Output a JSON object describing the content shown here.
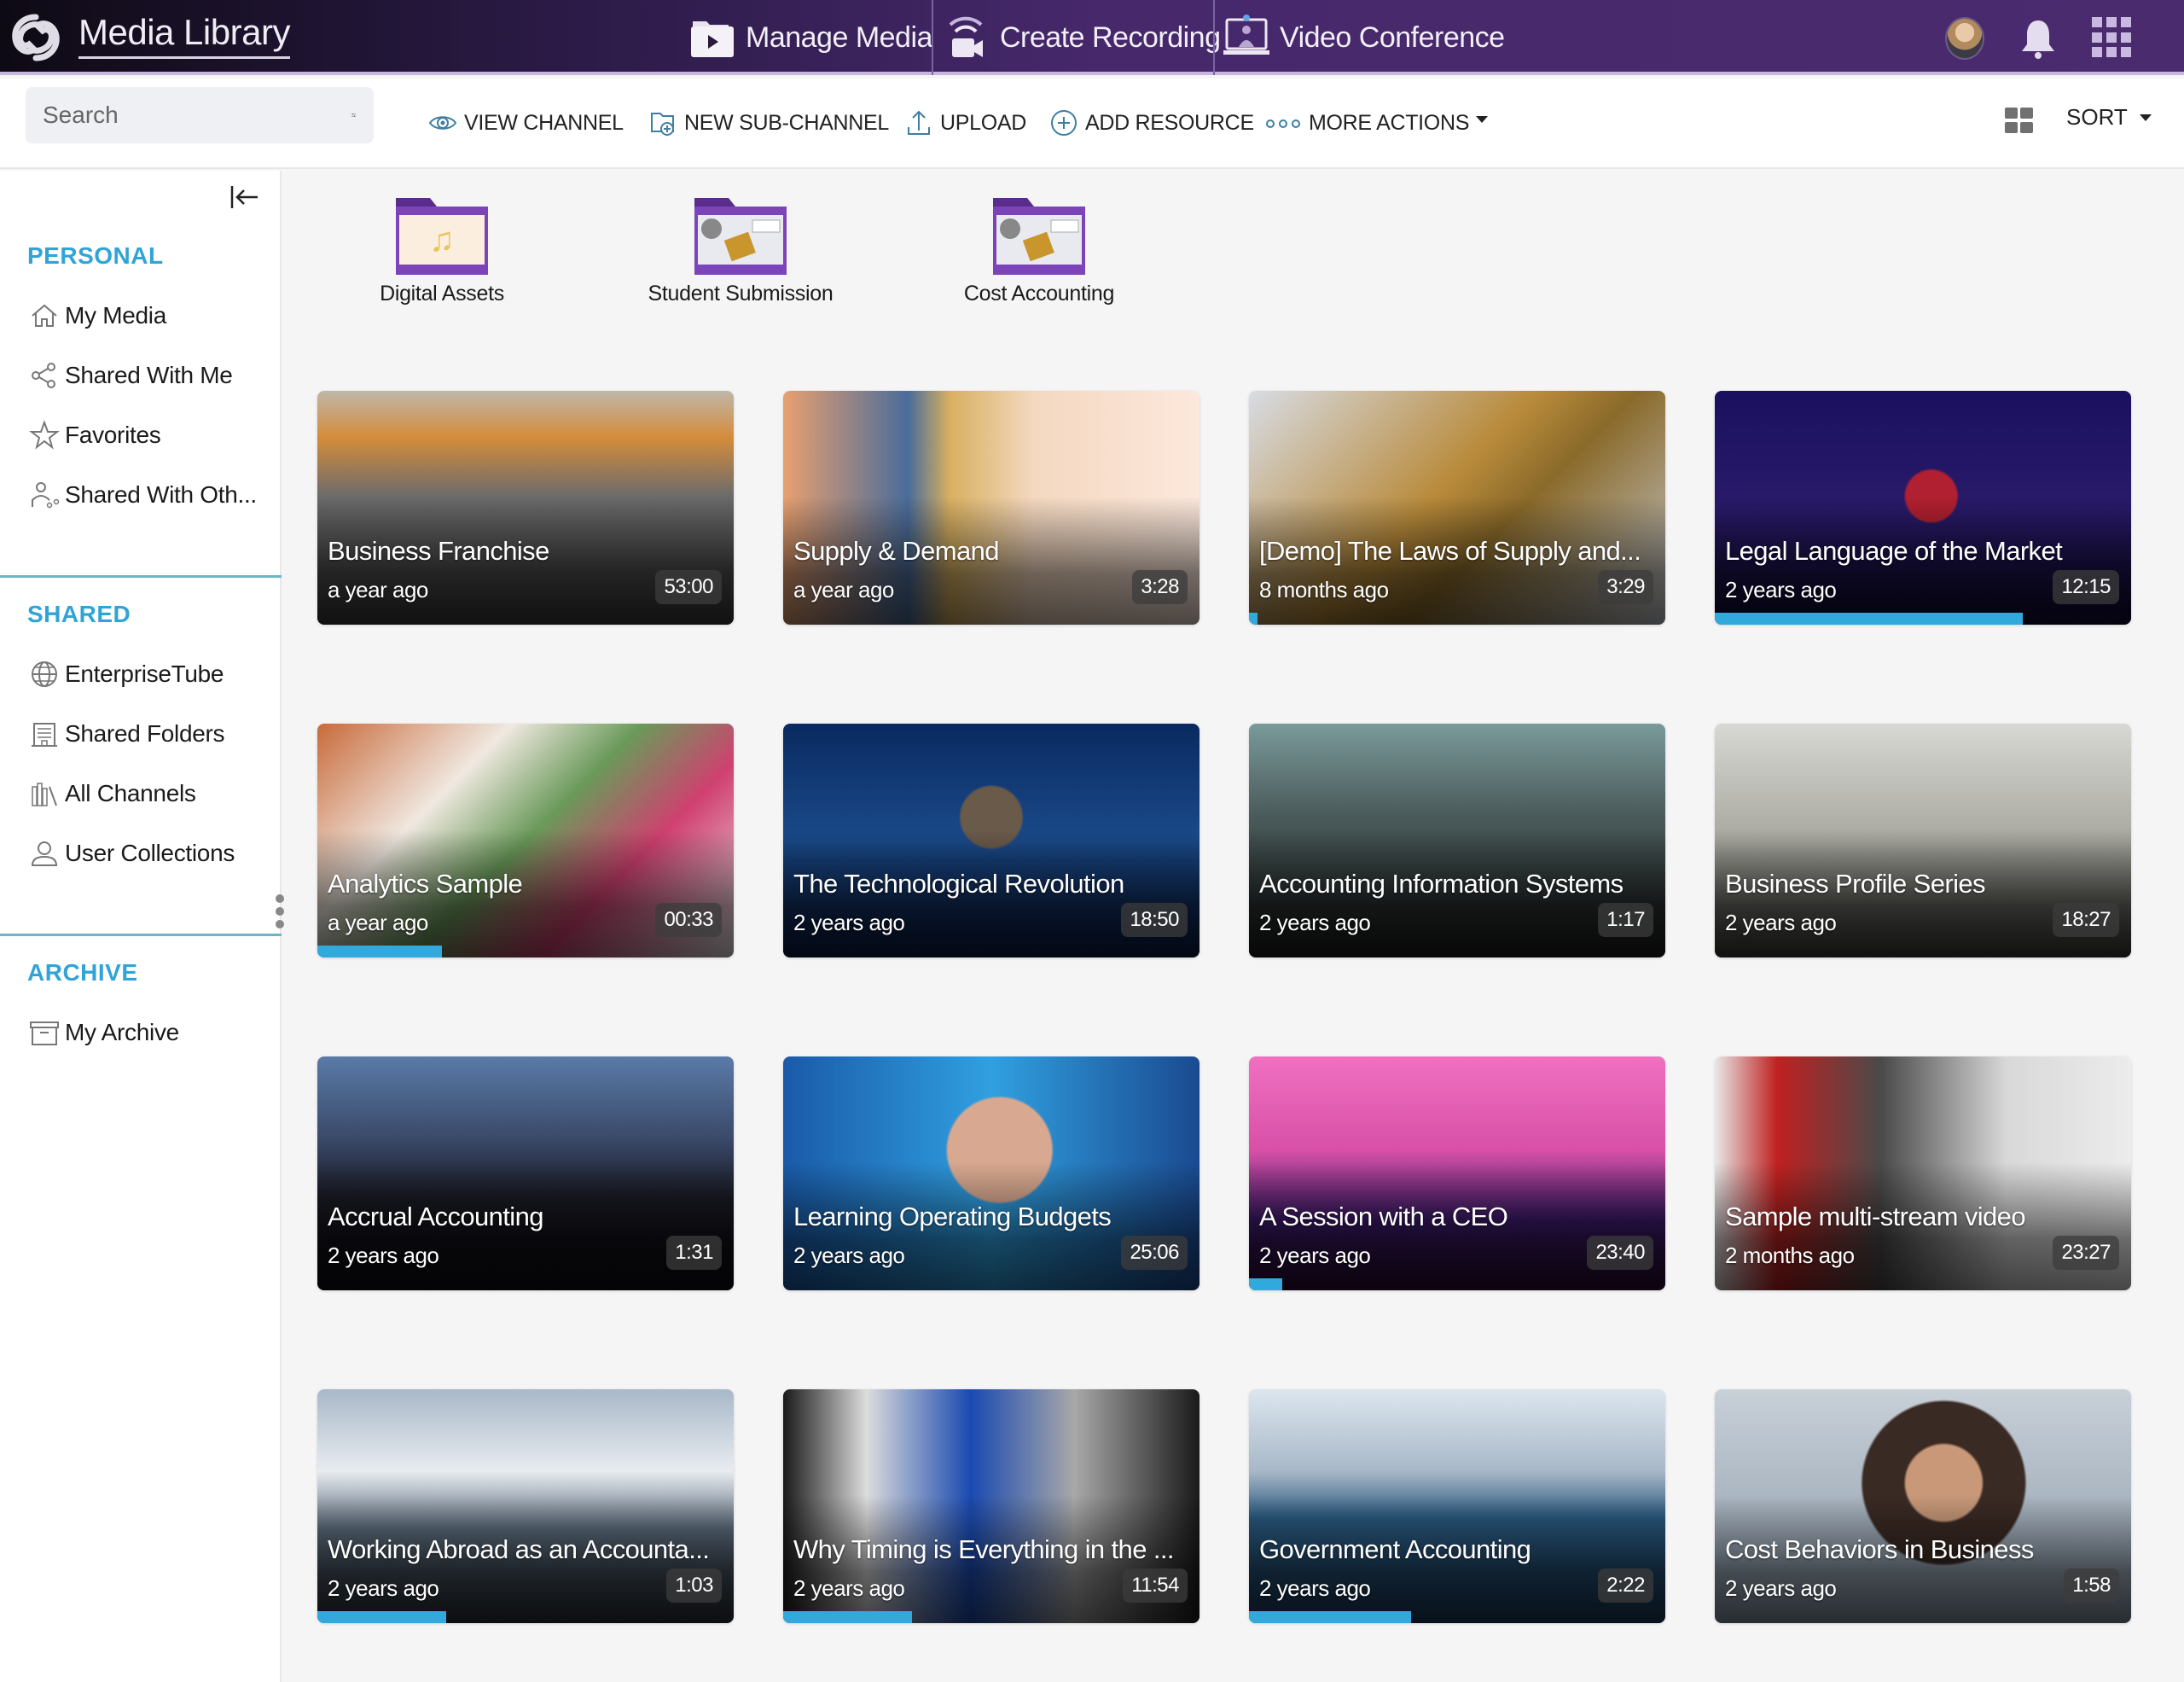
{
  "header": {
    "app_title": "Media Library",
    "nav": [
      {
        "label": "Manage Media",
        "icon": "manage-media-icon"
      },
      {
        "label": "Create Recording",
        "icon": "create-recording-icon"
      },
      {
        "label": "Video Conference",
        "icon": "video-conference-icon"
      }
    ],
    "right_icons": [
      "user-avatar",
      "notification-bell-icon",
      "apps-grid-icon"
    ]
  },
  "toolbar": {
    "search_placeholder": "Search",
    "actions": [
      {
        "label": "VIEW CHANNEL",
        "icon": "eye-icon"
      },
      {
        "label": "NEW SUB-CHANNEL",
        "icon": "new-folder-icon"
      },
      {
        "label": "UPLOAD",
        "icon": "upload-icon"
      },
      {
        "label": "ADD RESOURCE",
        "icon": "plus-circle-icon"
      },
      {
        "label": "MORE ACTIONS",
        "icon": "more-dots-icon"
      }
    ],
    "sort_label": "SORT"
  },
  "sidebar": {
    "sections": [
      {
        "title": "PERSONAL",
        "items": [
          {
            "label": "My Media",
            "icon": "home-icon"
          },
          {
            "label": "Shared With Me",
            "icon": "share-icon"
          },
          {
            "label": "Favorites",
            "icon": "star-icon"
          },
          {
            "label": "Shared With Oth...",
            "icon": "user-share-icon"
          }
        ]
      },
      {
        "title": "SHARED",
        "items": [
          {
            "label": "EnterpriseTube",
            "icon": "globe-icon"
          },
          {
            "label": "Shared Folders",
            "icon": "building-icon"
          },
          {
            "label": "All Channels",
            "icon": "library-icon"
          },
          {
            "label": "User Collections",
            "icon": "user-icon"
          }
        ]
      },
      {
        "title": "ARCHIVE",
        "items": [
          {
            "label": "My Archive",
            "icon": "archive-box-icon"
          }
        ]
      }
    ]
  },
  "folders": [
    {
      "label": "Digital Assets"
    },
    {
      "label": "Student Submission"
    },
    {
      "label": "Cost Accounting"
    }
  ],
  "colors": {
    "accent": "#30a4d6",
    "header_purple": "#4a2b6e",
    "folder_purple": "#7b44b8"
  },
  "videos": [
    {
      "title": "Business Franchise",
      "age": "a year ago",
      "duration": "53:00",
      "progress": 0
    },
    {
      "title": "Supply & Demand",
      "age": "a year ago",
      "duration": "3:28",
      "progress": 0
    },
    {
      "title": "[Demo] The Laws of Supply and...",
      "age": "8 months ago",
      "duration": "3:29",
      "progress": 0.02
    },
    {
      "title": "Legal Language of the Market",
      "age": "2 years ago",
      "duration": "12:15",
      "progress": 0.74
    },
    {
      "title": "Analytics Sample",
      "age": "a year ago",
      "duration": "00:33",
      "progress": 0.3
    },
    {
      "title": "The Technological Revolution",
      "age": "2 years ago",
      "duration": "18:50",
      "progress": 0
    },
    {
      "title": "Accounting Information Systems",
      "age": "2 years ago",
      "duration": "1:17",
      "progress": 0
    },
    {
      "title": "Business Profile Series",
      "age": "2 years ago",
      "duration": "18:27",
      "progress": 0
    },
    {
      "title": "Accrual Accounting",
      "age": "2 years ago",
      "duration": "1:31",
      "progress": 0
    },
    {
      "title": "Learning Operating Budgets",
      "age": "2 years ago",
      "duration": "25:06",
      "progress": 0
    },
    {
      "title": "A Session with a CEO",
      "age": "2 years ago",
      "duration": "23:40",
      "progress": 0.08
    },
    {
      "title": "Sample multi-stream video",
      "age": "2 months ago",
      "duration": "23:27",
      "progress": 0
    },
    {
      "title": "Working Abroad as an Accounta...",
      "age": "2 years ago",
      "duration": "1:03",
      "progress": 0.31
    },
    {
      "title": "Why Timing is Everything in the ...",
      "age": "2 years ago",
      "duration": "11:54",
      "progress": 0.31
    },
    {
      "title": "Government Accounting",
      "age": "2 years ago",
      "duration": "2:22",
      "progress": 0.39
    },
    {
      "title": "Cost Behaviors in Business",
      "age": "2 years ago",
      "duration": "1:58",
      "progress": 0
    }
  ]
}
